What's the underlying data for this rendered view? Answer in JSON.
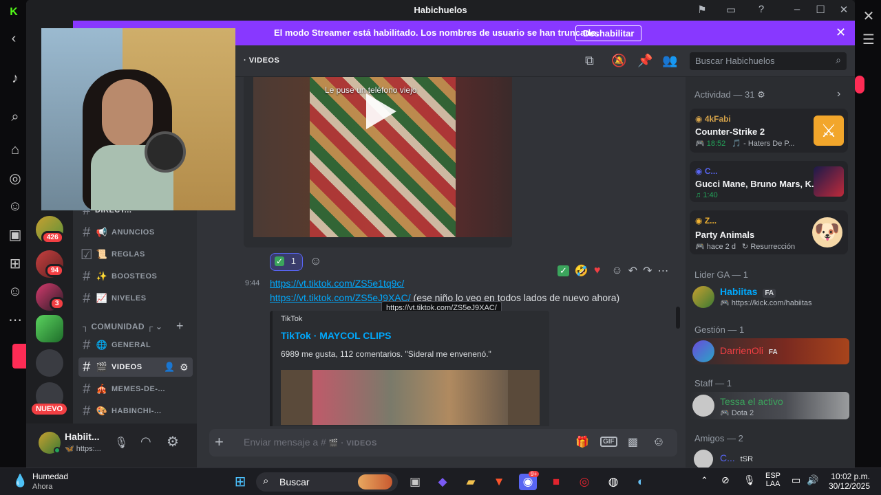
{
  "window": {
    "title": "Habichuelos"
  },
  "streamer": {
    "text": "El modo Streamer está habilitado. Los nombres de usuario se han truncado.",
    "button": "Deshabilitar"
  },
  "guilds": {
    "badges": [
      "426",
      "94",
      "3"
    ],
    "nuevo": "NUEVO"
  },
  "channels": {
    "direct": "DIRECT...",
    "items": [
      {
        "emoji": "📢",
        "label": "ANUNCIOS"
      },
      {
        "emoji": "📜",
        "label": "REGLAS"
      },
      {
        "emoji": "✨",
        "label": "BOOSTEOS"
      },
      {
        "emoji": "📈",
        "label": "NIVELES"
      }
    ],
    "category": "COMUNIDAD",
    "community": [
      {
        "emoji": "🌐",
        "label": "GENERAL"
      },
      {
        "emoji": "🎬",
        "label": "VIDEOS"
      },
      {
        "emoji": "🎪",
        "label": "MEMES-DE-..."
      },
      {
        "emoji": "🎨",
        "label": "HABINCHI-..."
      }
    ]
  },
  "user": {
    "name": "Habiit...",
    "status": "🦋 https:..."
  },
  "header": {
    "channel": "VIDEOS",
    "search_placeholder": "Buscar Habichuelos"
  },
  "messages": {
    "reaction_count": "1",
    "time": "9:44",
    "link1": "https://vt.tiktok.com/ZS5e1tq9c/",
    "link2": "https://vt.tiktok.com/ZS5eJ9XAC/",
    "text2": "(ese niño lo veo en todos lados de nuevo ahora)",
    "tooltip": "https://vt.tiktok.com/ZS5eJ9XAC/",
    "video_caption": "Le puse un teléfono viejo",
    "embed": {
      "provider": "TikTok",
      "title": "TikTok · MAYCOL CLIPS",
      "description": "6989 me gusta, 112 comentarios. \"Sideral me envenenó.\""
    }
  },
  "composer": {
    "placeholder": "Enviar mensaje a #",
    "channel": "VIDEOS"
  },
  "members": {
    "activity_header": "Actividad — 31",
    "activities": [
      {
        "user": "4kFabi",
        "game": "Counter-Strike 2",
        "time": "18:52",
        "extra": "🎵 - Haters De P..."
      },
      {
        "user": "C...",
        "game": "Gucci Mane, Bruno Mars, K...",
        "time": "1:40",
        "extra": ""
      },
      {
        "user": "Z...",
        "game": "Party Animals",
        "time": "hace 2 d",
        "extra": "Resurrección"
      }
    ],
    "sections": [
      {
        "title": "Lider GA — 1",
        "name": "Habiitas",
        "tag": "FA",
        "sub": "https://kick.com/habiitas"
      },
      {
        "title": "Gestión — 1",
        "name": "DarrienOli",
        "tag": "FA",
        "sub": ""
      },
      {
        "title": "Staff — 1",
        "name": "Tessa el activo",
        "tag": "",
        "sub": "Dota 2"
      },
      {
        "title": "Amigos — 2",
        "name": "C...",
        "tag": "tSR",
        "sub": ""
      }
    ]
  },
  "taskbar": {
    "weather_title": "Humedad",
    "weather_sub": "Ahora",
    "search": "Buscar",
    "lang": "ESP",
    "lang2": "LAA",
    "time": "10:02 p.m.",
    "date": "30/12/2025",
    "discord_badge": "9+"
  },
  "colors": {
    "accent": "#8838ff",
    "link": "#00a8fc",
    "taskbar": "#1c1d22",
    "discord_bg": "#313338"
  }
}
